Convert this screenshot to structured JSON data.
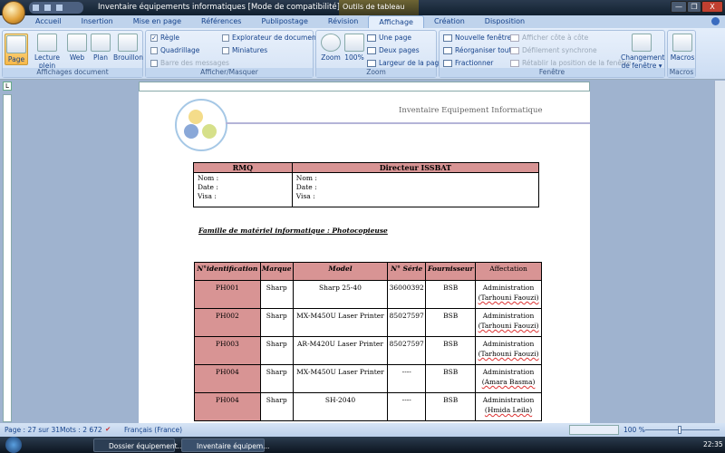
{
  "window": {
    "title": "Inventaire équipements informatiques [Mode de compatibilité] - Microsoft Word",
    "context_tab": "Outils de tableau",
    "minimize": "—",
    "restore": "❐",
    "close": "X"
  },
  "tabs": [
    "Accueil",
    "Insertion",
    "Mise en page",
    "Références",
    "Publipostage",
    "Révision",
    "Affichage",
    "Création",
    "Disposition"
  ],
  "ribbon": {
    "affichages": {
      "label": "Affichages document",
      "buttons": [
        "Page",
        "Lecture plein écran",
        "Web",
        "Plan",
        "Brouillon"
      ]
    },
    "afficher": {
      "label": "Afficher/Masquer",
      "regle": "Règle",
      "quadrillage": "Quadrillage",
      "barre": "Barre des messages",
      "explorateur": "Explorateur de documents",
      "miniatures": "Miniatures"
    },
    "zoom": {
      "label": "Zoom",
      "zoom": "Zoom",
      "pct": "100%",
      "une_page": "Une page",
      "deux_pages": "Deux pages",
      "largeur": "Largeur de la page"
    },
    "fenetre": {
      "label": "Fenêtre",
      "nouvelle": "Nouvelle fenêtre",
      "reorganiser": "Réorganiser tout",
      "fractionner": "Fractionner",
      "cote": "Afficher côte à côte",
      "defilement": "Défilement synchrone",
      "retablir": "Rétablir la position de la fenêtre",
      "changement": "Changement de fenêtre ▾"
    },
    "macros": {
      "label": "Macros",
      "button": "Macros"
    }
  },
  "ruler_button": "L",
  "document": {
    "header": "Inventaire Equipement Informatique",
    "sign_table": {
      "cols": [
        "RMQ",
        "Directeur ISSBAT"
      ],
      "lines": [
        "Nom    :",
        "Date    :",
        "Visa     :"
      ]
    },
    "family": "Famille de matériel informatique : Photocopieuse",
    "inventory": {
      "headers": [
        "N°identification",
        "Marque",
        "Model",
        "N° Série",
        "Fournisseur",
        "Affectation"
      ],
      "rows": [
        {
          "id": "PH001",
          "marque": "Sharp",
          "model": "Sharp 25-40",
          "serie": "36000392",
          "fournisseur": "BSB",
          "aff1": "Administration",
          "aff2": "(Tarhouni Faouzi)"
        },
        {
          "id": "PH002",
          "marque": "Sharp",
          "model": "MX-M450U Laser Printer",
          "serie": "85027597",
          "fournisseur": "BSB",
          "aff1": "Administration",
          "aff2": "(Tarhouni Faouzi)"
        },
        {
          "id": "PH003",
          "marque": "Sharp",
          "model": "AR-M420U Laser Printer",
          "serie": "85027597",
          "fournisseur": "BSB",
          "aff1": "Administration",
          "aff2": "(Tarhouni Faouzi)"
        },
        {
          "id": "PH004",
          "marque": "Sharp",
          "model": "MX-M450U Laser Printer",
          "serie": "----",
          "fournisseur": "BSB",
          "aff1": "Administration",
          "aff2": "(Amara Basma)"
        },
        {
          "id": "PH004",
          "marque": "Sharp",
          "model": "SH-2040",
          "serie": "----",
          "fournisseur": "BSB",
          "aff1": "Administration",
          "aff2": "(Hmida Leila)"
        }
      ]
    }
  },
  "status": {
    "page": "Page : 27 sur 31",
    "words": "Mots : 2 672",
    "language": "Français (France)",
    "zoom": "100 %"
  },
  "taskbar": {
    "items": [
      "Dossier équipement...",
      "Inventaire équipem..."
    ],
    "clock": "22:35"
  }
}
